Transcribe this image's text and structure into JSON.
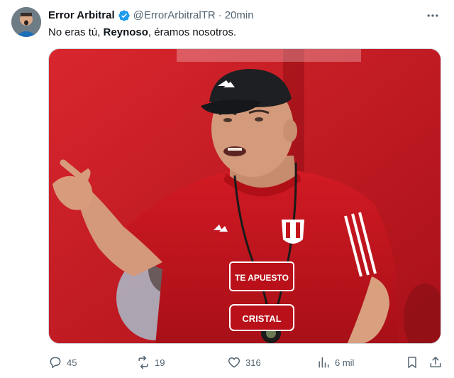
{
  "tweet": {
    "author_name": "Error Arbitral",
    "author_handle": "@ErrorArbitralTR",
    "separator": "·",
    "time": "20min",
    "text_before": "No eras tú, ",
    "text_bold": "Reynoso",
    "text_after": ", éramos nosotros.",
    "media": {
      "shirt_text_1": "TE APUESTO",
      "shirt_text_2": "CRISTAL"
    }
  },
  "actions": {
    "replies": "45",
    "retweets": "19",
    "likes": "316",
    "views": "6 mil"
  },
  "icons": {
    "verified": "verified-badge-icon",
    "more": "more-icon",
    "reply": "reply-icon",
    "retweet": "retweet-icon",
    "like": "heart-icon",
    "views": "views-icon",
    "bookmark": "bookmark-icon",
    "share": "share-icon"
  },
  "colors": {
    "verified": "#1d9bf0",
    "muted": "#536471",
    "shirt_red": "#c4151c"
  }
}
